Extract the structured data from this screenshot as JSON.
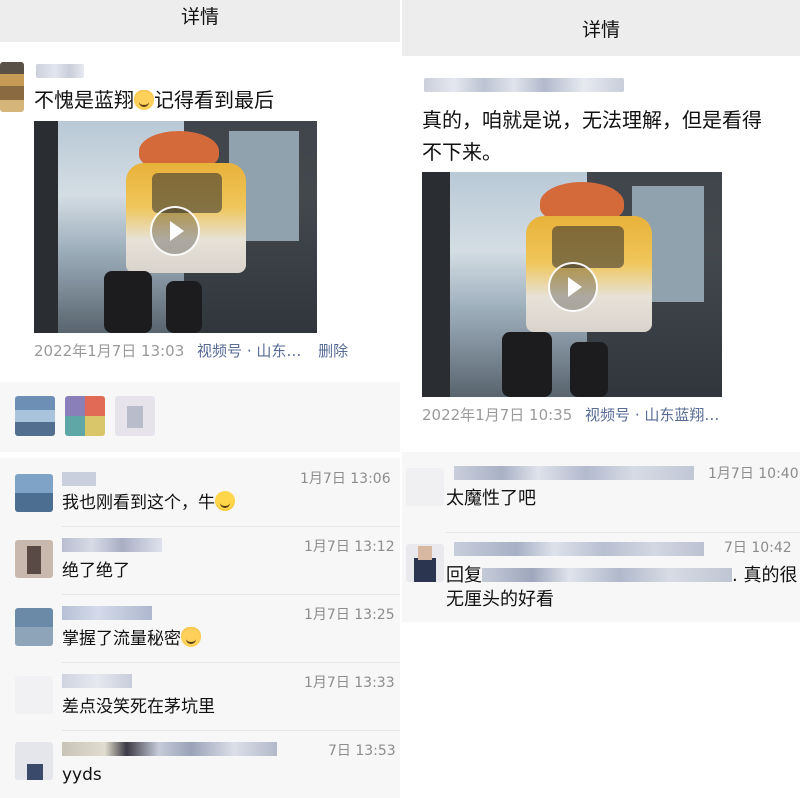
{
  "left": {
    "title": "详情",
    "post": {
      "text": "不愧是蓝翔",
      "text_after_emoji": "记得看到最后",
      "date": "2022年1月7日 13:03",
      "channel_link": "视频号 · 山东…",
      "delete_label": "删除"
    },
    "comments": [
      {
        "time": "1月7日 13:06",
        "text": "我也刚看到这个，牛"
      },
      {
        "time": "1月7日 13:12",
        "text": "绝了绝了"
      },
      {
        "time": "1月7日 13:25",
        "text": "掌握了流量秘密"
      },
      {
        "time": "1月7日 13:33",
        "text": "差点没笑死在茅坑里"
      },
      {
        "time": "7日 13:53",
        "text": "yyds"
      }
    ]
  },
  "right": {
    "title": "详情",
    "post": {
      "text_line1": "真的，咱就是说，无法理解，但是看得",
      "text_line2": "不下来。",
      "date": "2022年1月7日 10:35",
      "channel_link": "视频号 · 山东蓝翔…"
    },
    "comments": [
      {
        "time": "1月7日 10:40",
        "text": "太魔性了吧"
      },
      {
        "time": "7日 10:42",
        "reply_prefix": "回复",
        "text_tail": ". 真的很",
        "text_line2": "无厘头的好看"
      }
    ]
  },
  "colors": {
    "link": "#576b95",
    "meta": "#9a9a9a",
    "topbar": "#ededed",
    "comment_bg": "#f7f7f7"
  },
  "icons": {
    "play": "play-icon",
    "emoji_cat": "cat-emoji-icon",
    "emoji_grin": "grin-emoji-icon"
  }
}
